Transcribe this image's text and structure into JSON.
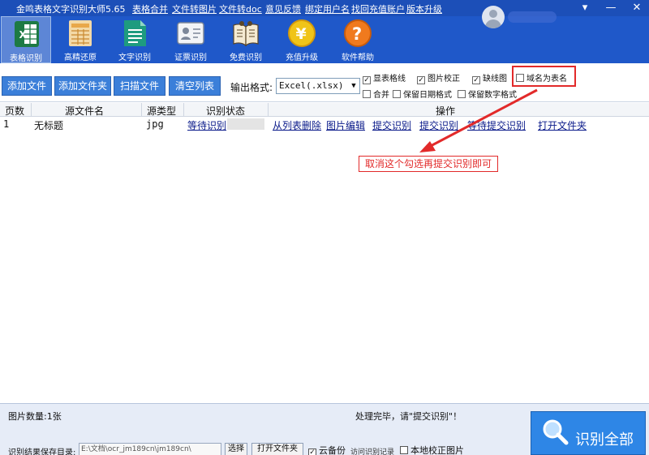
{
  "titlebar": {
    "title": "金鸣表格文字识别大师5.65",
    "links": [
      "表格合并",
      "文件转图片",
      "文件转doc",
      "意见反馈",
      "绑定用户名",
      "找回充值账户",
      "版本升级"
    ],
    "window_buttons": [
      "▾",
      "—",
      "✕"
    ]
  },
  "tools": [
    {
      "label": "表格识别",
      "icon": "excel-icon",
      "color": "#1d7a44"
    },
    {
      "label": "高精还原",
      "icon": "document-grid-icon",
      "color": "#e9a84a"
    },
    {
      "label": "文字识别",
      "icon": "text-document-icon",
      "color": "#1e9b7f"
    },
    {
      "label": "证票识别",
      "icon": "id-card-icon",
      "color": "#d8dde6"
    },
    {
      "label": "免费识别",
      "icon": "book-icon",
      "color": "#c49a5b"
    },
    {
      "label": "充值升级",
      "icon": "yen-coin-icon",
      "color": "#f0c419"
    },
    {
      "label": "软件帮助",
      "icon": "help-icon",
      "color": "#f07a1e"
    }
  ],
  "toolbar": {
    "buttons": [
      "添加文件",
      "添加文件夹",
      "扫描文件",
      "清空列表"
    ],
    "output_label": "输出格式:",
    "output_value": "Excel(.xlsx)",
    "checkboxes": [
      {
        "label": "显表格线",
        "checked": true
      },
      {
        "label": "图片校正",
        "checked": true
      },
      {
        "label": "缺线图",
        "checked": true
      },
      {
        "label": "域名为表名",
        "checked": false
      },
      {
        "label": "合并",
        "checked": false
      },
      {
        "label": "保留日期格式",
        "checked": false
      },
      {
        "label": "保留数字格式",
        "checked": false
      }
    ]
  },
  "table": {
    "headers": [
      "页数",
      "源文件名",
      "源类型",
      "识别状态",
      "操作"
    ],
    "rows": [
      {
        "page": "1",
        "name": "无标题",
        "type": "jpg",
        "status": "等待识别",
        "actions": [
          "从列表删除",
          "图片编辑",
          "提交识别",
          "提交识别",
          "等待提交识别",
          "打开文件夹"
        ]
      }
    ]
  },
  "annotation": {
    "text": "取消这个勾选再提交识别即可",
    "color": "#e22a2a"
  },
  "bottom": {
    "count": "图片数量:1张",
    "status": "处理完毕，请\"提交识别\"！",
    "save_label": "识别结果保存目录:",
    "save_path": "E:\\文档\\ocr_jm189cn\\jm189cn\\",
    "select_button": "选择",
    "open_folder_button": "打开文件夹",
    "cloud_backup": {
      "label": "云备份",
      "checked": true
    },
    "visit_records": "访问识别记录",
    "local_correct": {
      "label": "本地校正图片",
      "checked": false
    },
    "recognize_all": "识别全部"
  }
}
